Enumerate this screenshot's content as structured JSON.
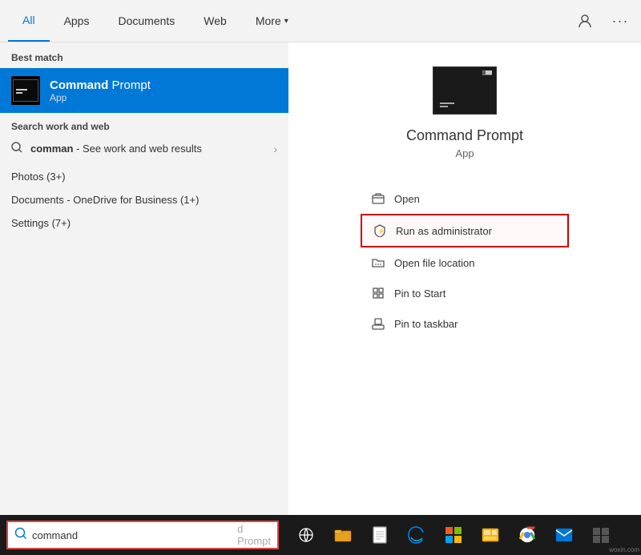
{
  "nav": {
    "tabs": [
      {
        "id": "all",
        "label": "All",
        "active": true
      },
      {
        "id": "apps",
        "label": "Apps",
        "active": false
      },
      {
        "id": "documents",
        "label": "Documents",
        "active": false
      },
      {
        "id": "web",
        "label": "Web",
        "active": false
      },
      {
        "id": "more",
        "label": "More",
        "active": false,
        "hasDropdown": true
      }
    ],
    "person_icon": "👤",
    "dots_icon": "···"
  },
  "left": {
    "best_match_label": "Best match",
    "best_match_title_bold": "Command",
    "best_match_title_rest": " Prompt",
    "best_match_subtitle": "App",
    "search_work_web_label": "Search work and web",
    "web_query": "comman",
    "web_query_suffix": " - See work and web results",
    "list_items": [
      "Photos (3+)",
      "Documents - OneDrive for Business (1+)",
      "Settings (7+)"
    ]
  },
  "right": {
    "app_name": "Command Prompt",
    "app_type": "App",
    "menu_items": [
      {
        "id": "open",
        "label": "Open",
        "icon": "open"
      },
      {
        "id": "run-admin",
        "label": "Run as administrator",
        "icon": "shield",
        "highlighted": true
      },
      {
        "id": "open-location",
        "label": "Open file location",
        "icon": "folder"
      },
      {
        "id": "pin-start",
        "label": "Pin to Start",
        "icon": "pin"
      },
      {
        "id": "pin-taskbar",
        "label": "Pin to taskbar",
        "icon": "pin2"
      }
    ]
  },
  "taskbar": {
    "search_placeholder": "command",
    "search_suffix": "d Prompt",
    "search_value": "command"
  }
}
